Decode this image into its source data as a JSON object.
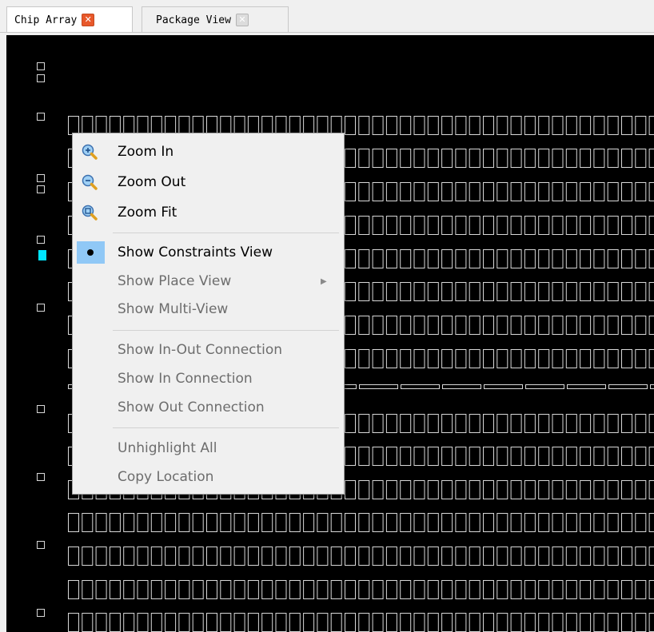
{
  "tabs": [
    {
      "label": "Chip Array",
      "active": true,
      "close_icon": "close-icon"
    },
    {
      "label": "Package View",
      "active": false,
      "close_icon": "close-icon"
    }
  ],
  "colors": {
    "canvas_bg": "#000000",
    "cell_outline": "#d8d8d8",
    "highlight_cell": "#00e5ff",
    "checked_bg": "#90c8f6",
    "close_active": "#e8582a"
  },
  "context_menu": {
    "groups": [
      [
        {
          "label": "Zoom In",
          "icon": "zoom-in-icon",
          "enabled": true
        },
        {
          "label": "Zoom Out",
          "icon": "zoom-out-icon",
          "enabled": true
        },
        {
          "label": "Zoom Fit",
          "icon": "zoom-fit-icon",
          "enabled": true
        }
      ],
      [
        {
          "label": "Show Constraints View",
          "checked": true,
          "enabled": true
        },
        {
          "label": "Show Place View",
          "enabled": false,
          "submenu": true
        },
        {
          "label": "Show Multi-View",
          "enabled": false
        }
      ],
      [
        {
          "label": "Show In-Out Connection",
          "enabled": false
        },
        {
          "label": "Show In Connection",
          "enabled": false
        },
        {
          "label": "Show Out Connection",
          "enabled": false
        }
      ],
      [
        {
          "label": "Unhighlight All",
          "enabled": false
        },
        {
          "label": "Copy Location",
          "enabled": false
        }
      ]
    ]
  }
}
